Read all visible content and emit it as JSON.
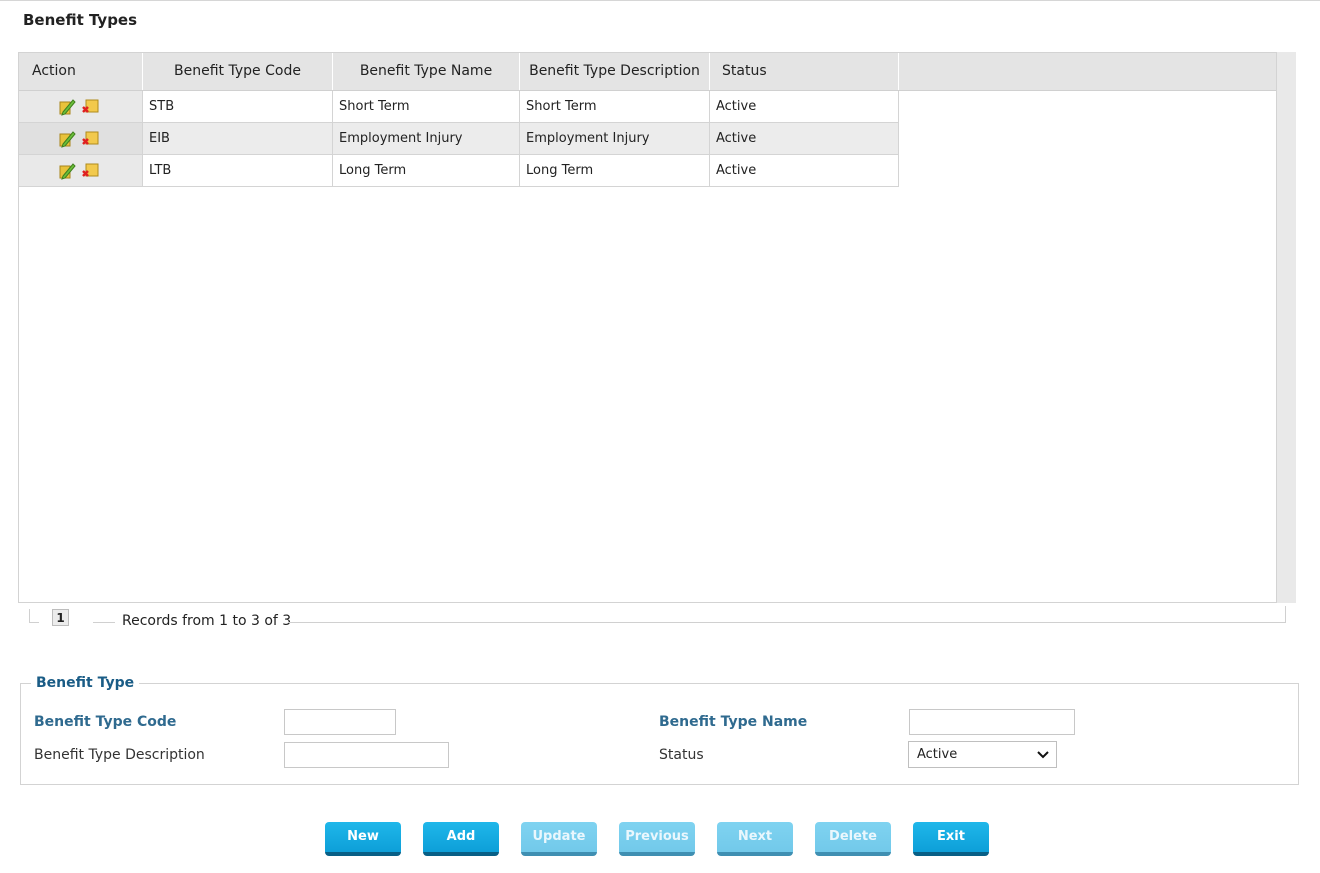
{
  "page": {
    "title": "Benefit Types"
  },
  "grid": {
    "columns": [
      "Action",
      "Benefit Type Code",
      "Benefit Type Name",
      "Benefit Type Description",
      "Status"
    ],
    "rows": [
      {
        "code": "STB",
        "name": "Short Term",
        "description": "Short Term",
        "status": "Active"
      },
      {
        "code": "EIB",
        "name": "Employment Injury",
        "description": "Employment Injury",
        "status": "Active"
      },
      {
        "code": "LTB",
        "name": "Long Term",
        "description": "Long Term",
        "status": "Active"
      }
    ],
    "row_action_icons": [
      "edit-icon",
      "delete-icon"
    ]
  },
  "pager": {
    "current_page": "1",
    "records_text": "Records from 1 to 3 of 3"
  },
  "form": {
    "legend": "Benefit Type",
    "code_label": "Benefit Type Code",
    "code_value": "",
    "name_label": "Benefit Type Name",
    "name_value": "",
    "description_label": "Benefit Type Description",
    "description_value": "",
    "status_label": "Status",
    "status_value": "Active"
  },
  "buttons": [
    {
      "label": "New",
      "enabled": true
    },
    {
      "label": "Add",
      "enabled": true
    },
    {
      "label": "Update",
      "enabled": false
    },
    {
      "label": "Previous",
      "enabled": false
    },
    {
      "label": "Next",
      "enabled": false
    },
    {
      "label": "Delete",
      "enabled": false
    },
    {
      "label": "Exit",
      "enabled": true
    }
  ],
  "colors": {
    "accent": "#0fa6dd",
    "label_blue": "#2f6a8f",
    "legend_blue": "#1a5c86"
  }
}
